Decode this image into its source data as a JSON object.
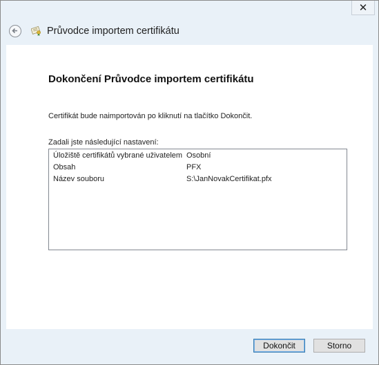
{
  "titlebar": {
    "close_symbol": "✕"
  },
  "header": {
    "title": "Průvodce importem certifikátu",
    "back_icon": "back-arrow-icon",
    "app_icon": "certificate-icon"
  },
  "main": {
    "heading": "Dokončení Průvodce importem certifikátu",
    "info": "Certifikát bude naimportován po kliknutí na tlačítko Dokončit.",
    "settings_label": "Zadali jste následující nastavení:",
    "settings": [
      {
        "key": "Úložiště certifikátů vybrané uživatelem",
        "value": "Osobní"
      },
      {
        "key": "Obsah",
        "value": "PFX"
      },
      {
        "key": "Název souboru",
        "value": "S:\\JanNovakCertifikat.pfx"
      }
    ]
  },
  "footer": {
    "finish_label": "Dokončit",
    "cancel_label": "Storno"
  },
  "colors": {
    "frame_bg": "#e9f1f8",
    "default_button_border": "#3c7fb1"
  }
}
